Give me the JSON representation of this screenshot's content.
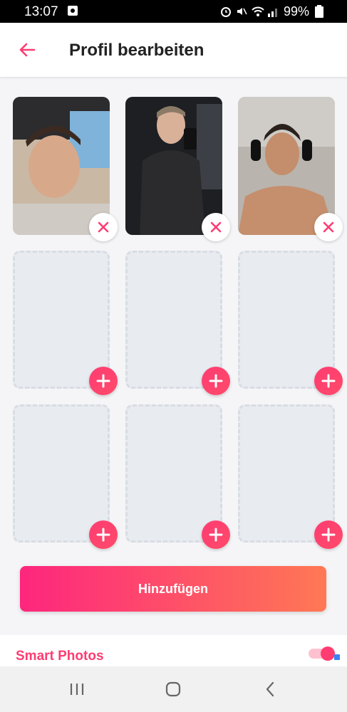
{
  "status_bar": {
    "time": "13:07",
    "battery": "99%"
  },
  "header": {
    "title": "Profil bearbeiten",
    "back_icon": "arrow-left-icon"
  },
  "photos": [
    {
      "slot": 1,
      "filled": true,
      "action_icon": "close-icon"
    },
    {
      "slot": 2,
      "filled": true,
      "action_icon": "close-icon"
    },
    {
      "slot": 3,
      "filled": true,
      "action_icon": "close-icon"
    },
    {
      "slot": 4,
      "filled": false,
      "action_icon": "plus-icon"
    },
    {
      "slot": 5,
      "filled": false,
      "action_icon": "plus-icon"
    },
    {
      "slot": 6,
      "filled": false,
      "action_icon": "plus-icon"
    },
    {
      "slot": 7,
      "filled": false,
      "action_icon": "plus-icon"
    },
    {
      "slot": 8,
      "filled": false,
      "action_icon": "plus-icon"
    },
    {
      "slot": 9,
      "filled": false,
      "action_icon": "plus-icon"
    }
  ],
  "add_button": {
    "label": "Hinzufügen"
  },
  "smart_photos": {
    "label": "Smart Photos",
    "enabled": true
  },
  "colors": {
    "accent": "#fe3c72",
    "gradient_start": "#fd267d",
    "gradient_end": "#ff7854"
  }
}
